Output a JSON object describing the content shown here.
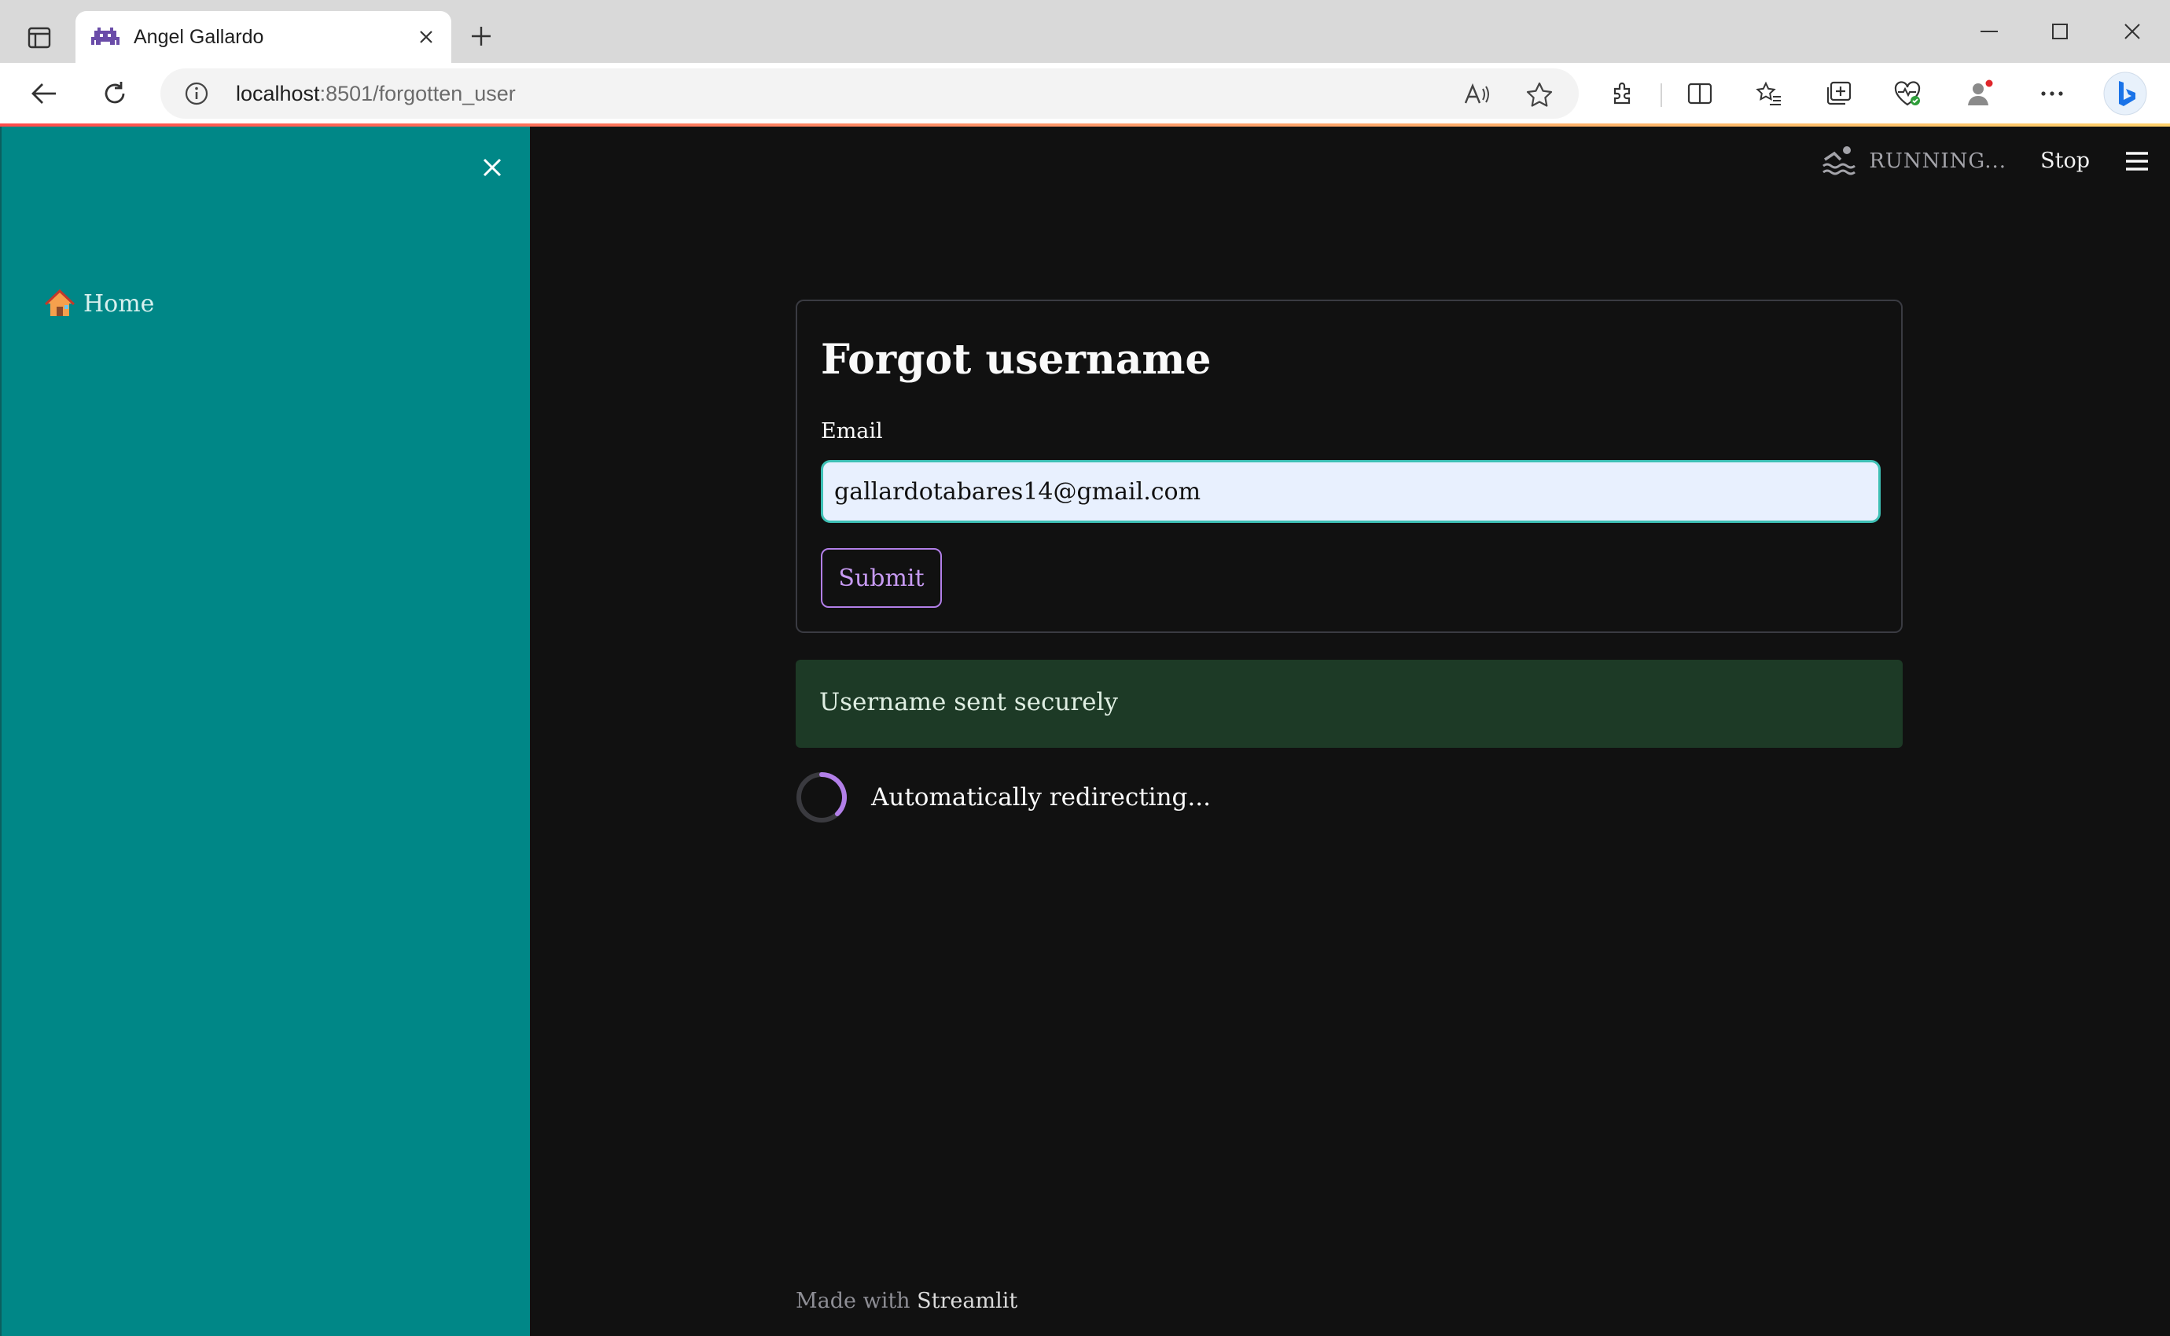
{
  "browser": {
    "tab_title": "Angel Gallardo",
    "url_host": "localhost",
    "url_rest": ":8501/forgotten_user"
  },
  "app": {
    "status_label": "RUNNING...",
    "stop_label": "Stop",
    "sidebar": {
      "items": [
        {
          "label": "Home",
          "icon": "house-icon"
        }
      ]
    },
    "form": {
      "title": "Forgot username",
      "email_label": "Email",
      "email_value": "gallardotabares14@gmail.com",
      "submit_label": "Submit"
    },
    "success_message": "Username sent securely",
    "spinner_text": "Automatically redirecting...",
    "footer": {
      "prefix": "Made with",
      "brand": "Streamlit"
    },
    "colors": {
      "sidebar_bg": "#008787",
      "main_bg": "#111111",
      "success_bg": "#1d3a26",
      "accent": "#b27fe8",
      "input_border": "#3ec0b5"
    }
  }
}
